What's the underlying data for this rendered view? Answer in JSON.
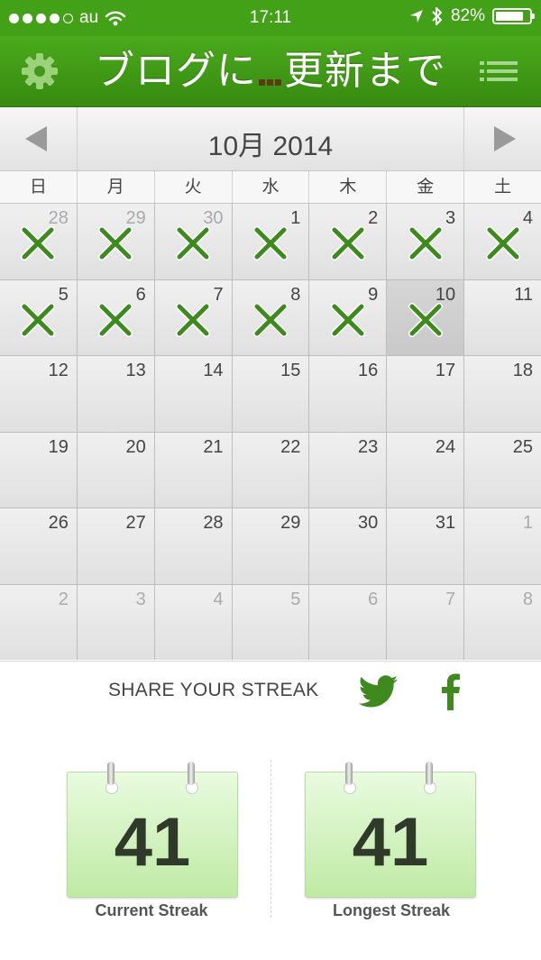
{
  "status": {
    "carrier": "au",
    "time": "17:11",
    "battery_percent": "82%",
    "battery_level": 0.82,
    "signal_bars_filled": 4,
    "signal_bars_total": 5
  },
  "nav": {
    "title_part1": "ブログに",
    "title_part2": "更新まで",
    "left_icon": "gear-icon",
    "right_icon": "menu-icon"
  },
  "calendar": {
    "month_title": "10月 2014",
    "weekdays": [
      "日",
      "月",
      "火",
      "水",
      "木",
      "金",
      "土"
    ],
    "today": "10",
    "days": [
      {
        "n": "28",
        "other": true,
        "x": true
      },
      {
        "n": "29",
        "other": true,
        "x": true
      },
      {
        "n": "30",
        "other": true,
        "x": true
      },
      {
        "n": "1",
        "other": false,
        "x": true
      },
      {
        "n": "2",
        "other": false,
        "x": true
      },
      {
        "n": "3",
        "other": false,
        "x": true
      },
      {
        "n": "4",
        "other": false,
        "x": true
      },
      {
        "n": "5",
        "other": false,
        "x": true
      },
      {
        "n": "6",
        "other": false,
        "x": true
      },
      {
        "n": "7",
        "other": false,
        "x": true
      },
      {
        "n": "8",
        "other": false,
        "x": true
      },
      {
        "n": "9",
        "other": false,
        "x": true
      },
      {
        "n": "10",
        "other": false,
        "x": true,
        "today": true
      },
      {
        "n": "11",
        "other": false,
        "x": false
      },
      {
        "n": "12",
        "other": false,
        "x": false
      },
      {
        "n": "13",
        "other": false,
        "x": false
      },
      {
        "n": "14",
        "other": false,
        "x": false
      },
      {
        "n": "15",
        "other": false,
        "x": false
      },
      {
        "n": "16",
        "other": false,
        "x": false
      },
      {
        "n": "17",
        "other": false,
        "x": false
      },
      {
        "n": "18",
        "other": false,
        "x": false
      },
      {
        "n": "19",
        "other": false,
        "x": false
      },
      {
        "n": "20",
        "other": false,
        "x": false
      },
      {
        "n": "21",
        "other": false,
        "x": false
      },
      {
        "n": "22",
        "other": false,
        "x": false
      },
      {
        "n": "23",
        "other": false,
        "x": false
      },
      {
        "n": "24",
        "other": false,
        "x": false
      },
      {
        "n": "25",
        "other": false,
        "x": false
      },
      {
        "n": "26",
        "other": false,
        "x": false
      },
      {
        "n": "27",
        "other": false,
        "x": false
      },
      {
        "n": "28",
        "other": false,
        "x": false
      },
      {
        "n": "29",
        "other": false,
        "x": false
      },
      {
        "n": "30",
        "other": false,
        "x": false
      },
      {
        "n": "31",
        "other": false,
        "x": false
      },
      {
        "n": "1",
        "other": true,
        "x": false
      },
      {
        "n": "2",
        "other": true,
        "x": false
      },
      {
        "n": "3",
        "other": true,
        "x": false
      },
      {
        "n": "4",
        "other": true,
        "x": false
      },
      {
        "n": "5",
        "other": true,
        "x": false
      },
      {
        "n": "6",
        "other": true,
        "x": false
      },
      {
        "n": "7",
        "other": true,
        "x": false
      },
      {
        "n": "8",
        "other": true,
        "x": false
      }
    ]
  },
  "share": {
    "label": "SHARE YOUR STREAK",
    "icons": [
      "twitter-icon",
      "facebook-icon"
    ]
  },
  "streaks": {
    "current_value": "41",
    "current_label": "Current Streak",
    "longest_value": "41",
    "longest_label": "Longest Streak"
  },
  "colors": {
    "brand_green": "#43a118",
    "mark_green": "#3f8a1e",
    "card_green": "#bfeaa4"
  }
}
